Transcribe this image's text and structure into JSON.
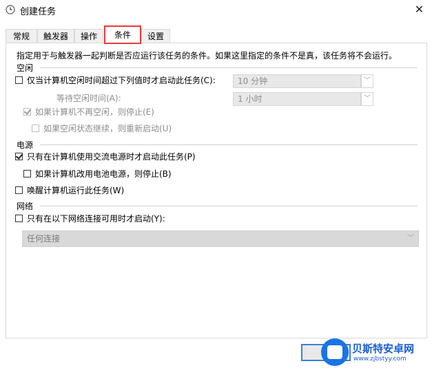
{
  "window": {
    "title": "创建任务",
    "close_glyph": "✕"
  },
  "tabs": [
    {
      "label": "常规",
      "active": false
    },
    {
      "label": "触发器",
      "active": false
    },
    {
      "label": "操作",
      "active": false
    },
    {
      "label": "条件",
      "active": true
    },
    {
      "label": "设置",
      "active": false
    }
  ],
  "description": "指定用于与触发器一起判断是否应运行该任务的条件。如果这里指定的条件不是真，该任务将不会运行。",
  "idle": {
    "heading": "空闲",
    "start_if_idle": {
      "label": "仅当计算机空闲时间超过下列值时才启动此任务(C):",
      "checked": false
    },
    "idle_duration": "10 分钟",
    "wait_label": "等待空闲时间(A):",
    "wait_duration": "1 小时",
    "stop_if_not_idle": {
      "label": "如果计算机不再空闲，则停止(E)",
      "checked": true
    },
    "restart_if_idle": {
      "label": "如果空闲状态继续，则重新启动(U)",
      "checked": false
    }
  },
  "power": {
    "heading": "电源",
    "ac_only": {
      "label": "只有在计算机使用交流电源时才启动此任务(P)",
      "checked": true
    },
    "stop_on_battery": {
      "label": "如果计算机改用电池电源，则停止(B)",
      "checked": false
    },
    "wake": {
      "label": "唤醒计算机运行此任务(W)",
      "checked": false
    }
  },
  "network": {
    "heading": "网络",
    "only_if_network": {
      "label": "只有在以下网络连接可用时才启动(Y):",
      "checked": false
    },
    "connection": "任何连接"
  },
  "watermark": {
    "name": "贝斯特安卓网",
    "url": "www.zjbstyy.com"
  },
  "colors": {
    "highlight": "#e43c3c",
    "button_focus": "#3c7fd1",
    "watermark": "#1a5fd1"
  }
}
